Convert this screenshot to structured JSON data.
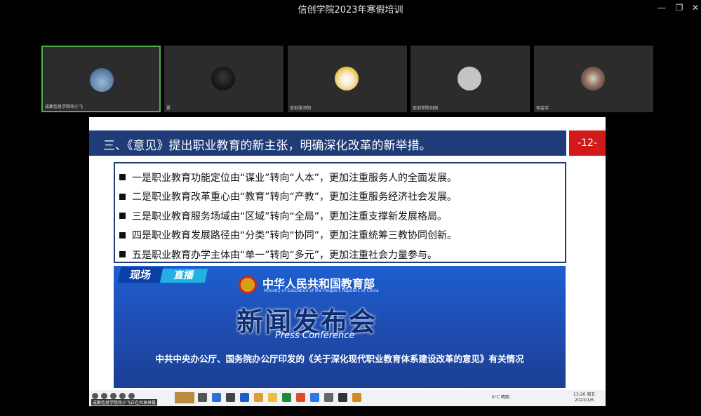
{
  "window": {
    "title": "信创学院2023年寒假培训",
    "controls": [
      "minimize-icon",
      "restore-icon",
      "close-icon"
    ]
  },
  "participants": [
    {
      "name": "成都信息学院邓小飞",
      "avatar": "airplane-photo",
      "active": true
    },
    {
      "name": "夏",
      "avatar": "cat-photo",
      "active": false
    },
    {
      "name": "信创张河阳",
      "avatar": "cartoon-photo",
      "active": false
    },
    {
      "name": "信创学院刘刚",
      "avatar": "default-gray",
      "active": false
    },
    {
      "name": "何金宇",
      "avatar": "group-photo",
      "active": false
    }
  ],
  "slide": {
    "heading": "三、《意见》提出职业教育的新主张，明确深化改革的新举措。",
    "page_number": "-12-",
    "points": [
      "一是职业教育功能定位由“谋业”转向“人本”，更加注重服务人的全面发展。",
      "二是职业教育改革重心由“教育”转向“产教”，更加注重服务经济社会发展。",
      "三是职业教育服务场域由“区域”转向“全局”，更加注重支撑新发展格局。",
      "四是职业教育发展路径由“分类”转向“协同”，更加注重统筹三教协同创新。",
      "五是职业教育办学主体由“单一”转向“多元”，更加注重社会力量参与。"
    ],
    "photo": {
      "tag_1": "现场",
      "tag_2": "直播",
      "ministry_cn": "中华人民共和国教育部",
      "ministry_en": "Ministry of Education of the People's Republic of China",
      "conference_cn": "新闻发布会",
      "conference_en": "Press Conference",
      "caption": "中共中央办公厅、国务院办公厅印发的《关于深化现代职业教育体系建设改革的意见》有关情况"
    }
  },
  "taskbar": {
    "sharer_label": "成都信息学院邓小飞正在共享屏幕",
    "weather": "6°C 晴朗",
    "clock_time": "13:26 周五",
    "clock_date": "2023/1/6"
  },
  "colors": {
    "heading_bar": "#1f3c78",
    "page_badge": "#d11a1a",
    "active_tile_border": "#4caf50"
  }
}
